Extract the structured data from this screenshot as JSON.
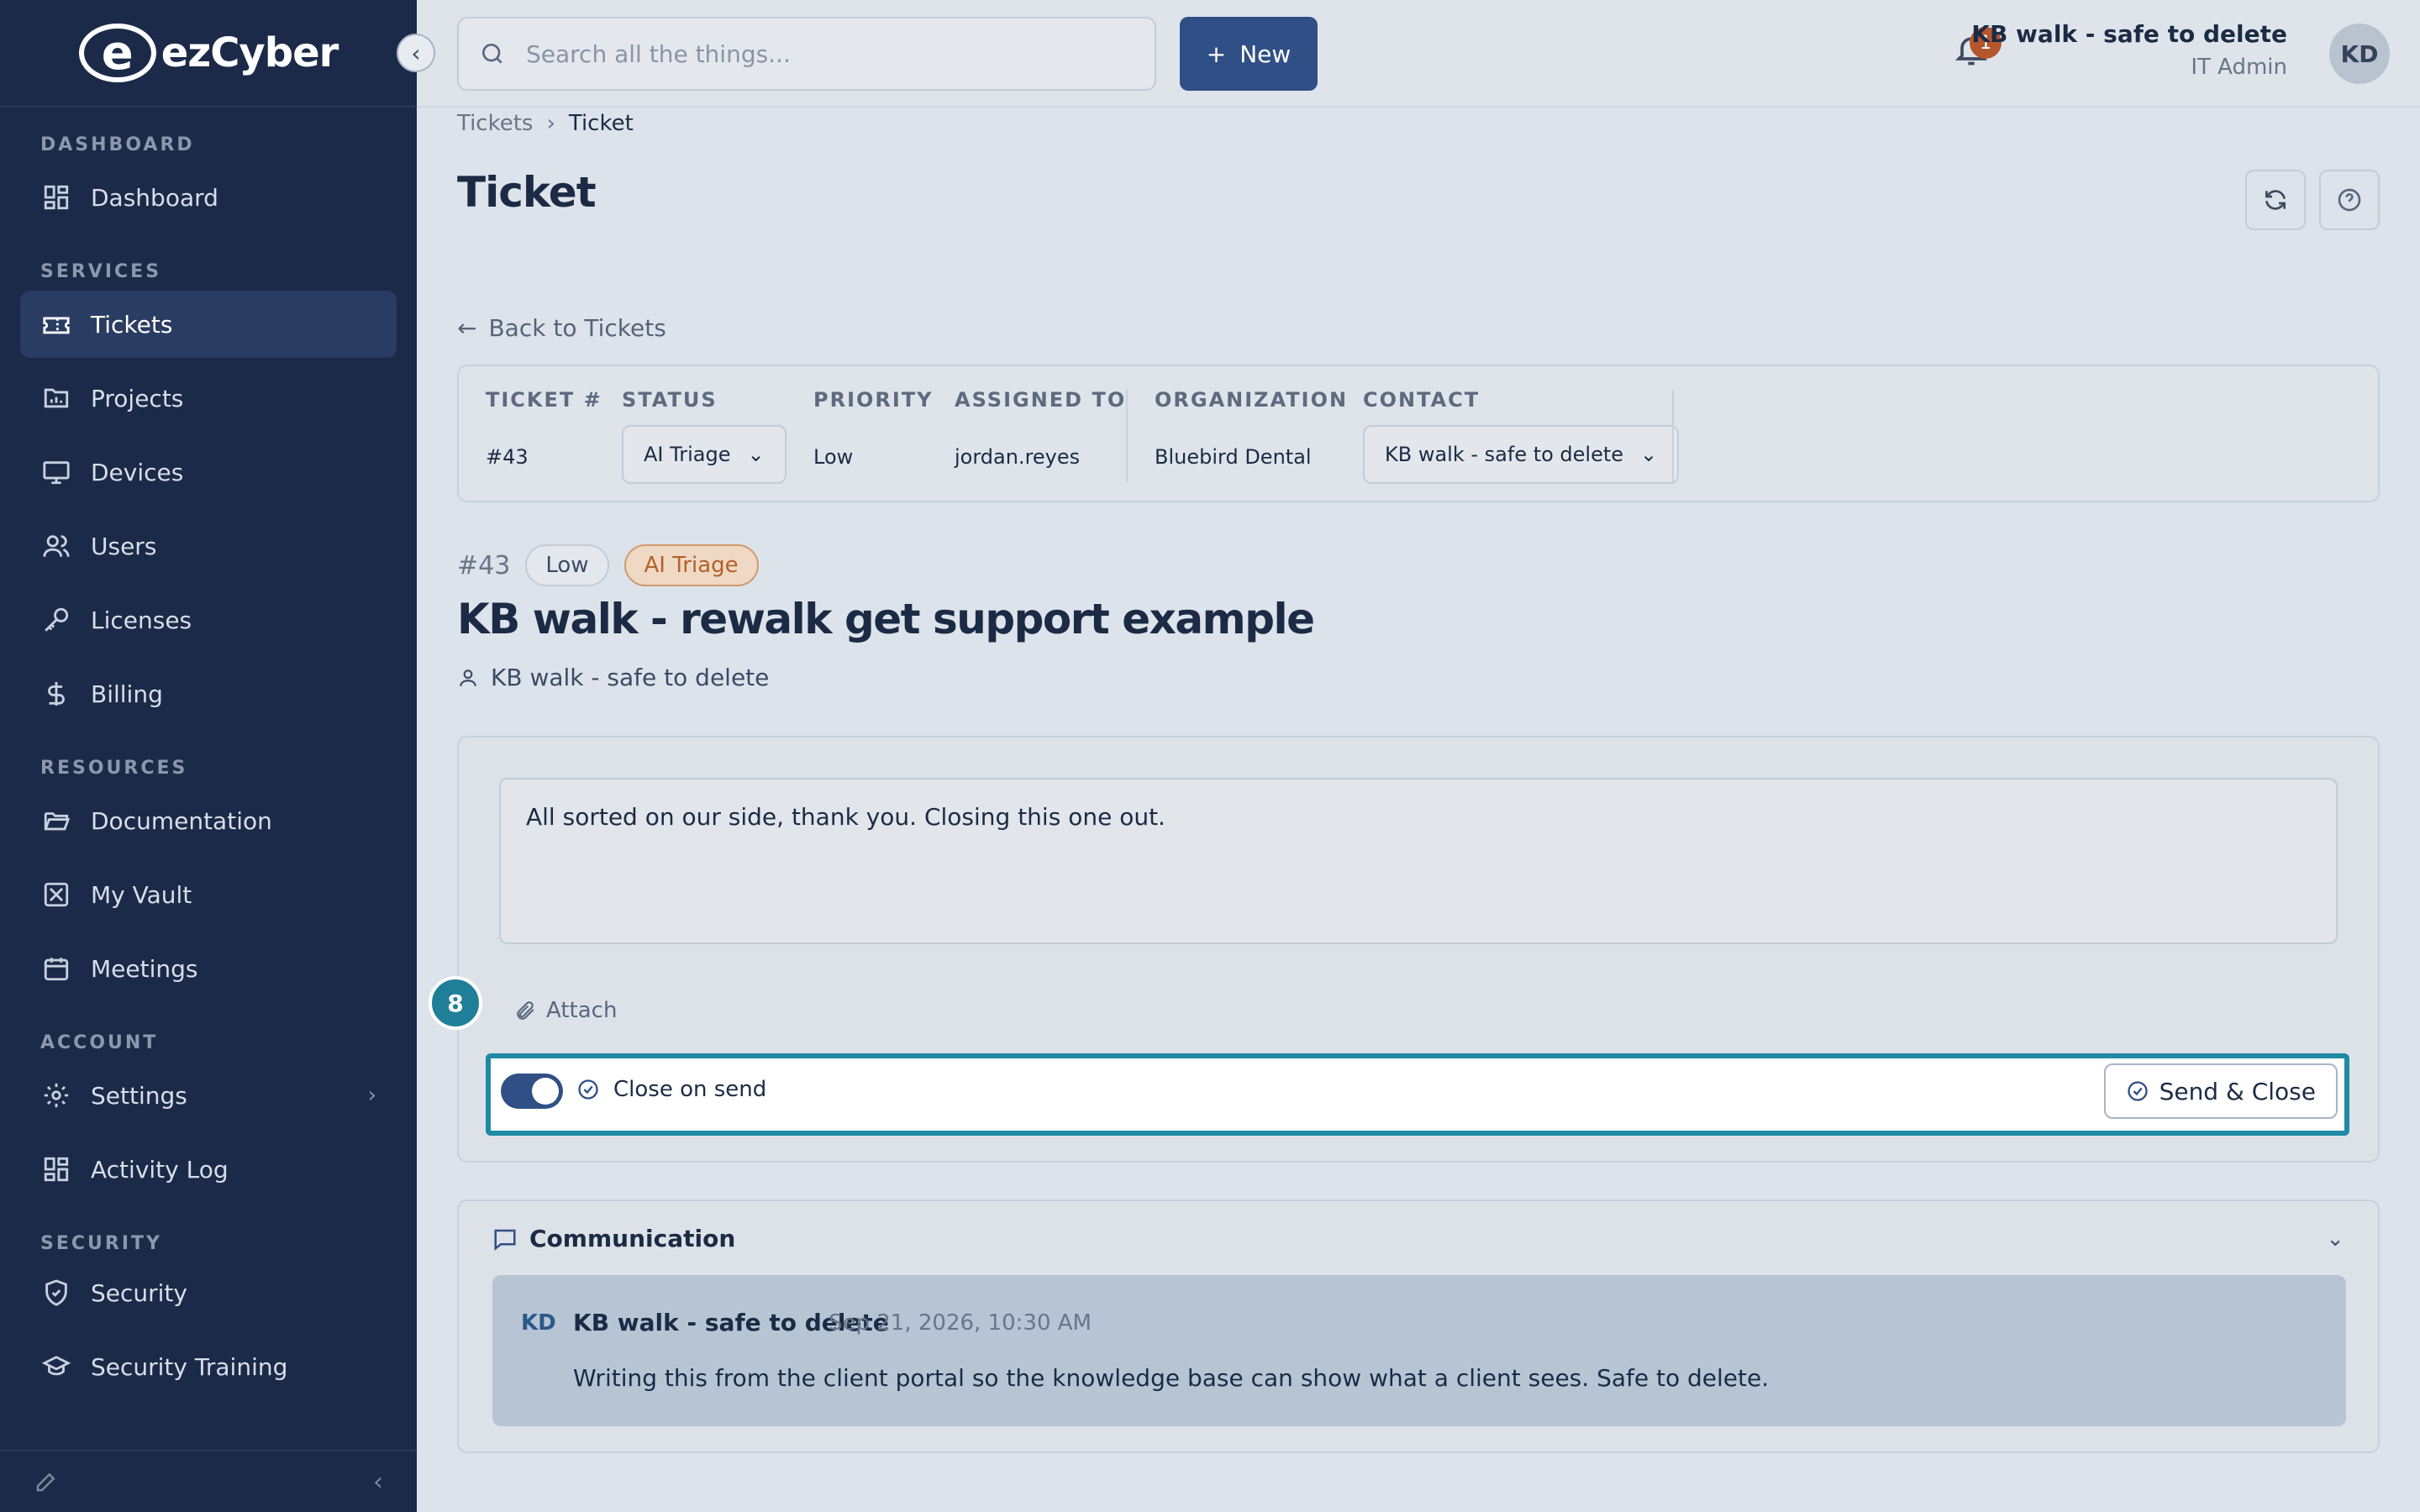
{
  "brand": {
    "name": "ezCyber",
    "mark": "e"
  },
  "sidebar": {
    "sections": [
      {
        "title": "DASHBOARD",
        "items": [
          {
            "label": "Dashboard",
            "icon": "grid-icon"
          }
        ]
      },
      {
        "title": "SERVICES",
        "items": [
          {
            "label": "Tickets",
            "icon": "ticket-icon",
            "active": true
          },
          {
            "label": "Projects",
            "icon": "folder-chart-icon"
          },
          {
            "label": "Devices",
            "icon": "monitor-icon"
          },
          {
            "label": "Users",
            "icon": "users-icon"
          },
          {
            "label": "Licenses",
            "icon": "key-icon"
          },
          {
            "label": "Billing",
            "icon": "dollar-icon"
          }
        ]
      },
      {
        "title": "RESOURCES",
        "items": [
          {
            "label": "Documentation",
            "icon": "folder-open-icon"
          },
          {
            "label": "My Vault",
            "icon": "vault-icon"
          },
          {
            "label": "Meetings",
            "icon": "calendar-icon"
          }
        ]
      },
      {
        "title": "ACCOUNT",
        "items": [
          {
            "label": "Settings",
            "icon": "gear-icon",
            "expandable": true
          },
          {
            "label": "Activity Log",
            "icon": "grid-icon"
          }
        ]
      },
      {
        "title": "SECURITY",
        "items": [
          {
            "label": "Security",
            "icon": "shield-icon"
          },
          {
            "label": "Security Training",
            "icon": "graduation-cap-icon"
          }
        ]
      }
    ]
  },
  "topbar": {
    "search_placeholder": "Search all the things...",
    "new_label": "New",
    "notification_count": "1",
    "user_name": "KB walk - safe to delete",
    "user_role": "IT Admin",
    "user_initials": "KD"
  },
  "breadcrumb": {
    "parent": "Tickets",
    "current": "Ticket"
  },
  "page_title": "Ticket",
  "back_label": "Back to Tickets",
  "meta": {
    "ticket_no_h": "TICKET #",
    "ticket_no": "#43",
    "status_h": "STATUS",
    "status": "AI Triage",
    "priority_h": "PRIORITY",
    "priority": "Low",
    "assigned_h": "ASSIGNED TO",
    "assigned": "jordan.reyes",
    "org_h": "ORGANIZATION",
    "org": "Bluebird Dental",
    "contact_h": "CONTACT",
    "contact": "KB walk - safe to delete"
  },
  "ticket": {
    "id": "#43",
    "priority_tag": "Low",
    "status_tag": "AI Triage",
    "title": "KB walk - rewalk get support example",
    "submitter": "KB walk - safe to delete"
  },
  "reply": {
    "text": "All sorted on our side, thank you. Closing this one out.",
    "attach_label": "Attach",
    "step_number": "8",
    "close_on_send_label": "Close on send",
    "close_on_send": true,
    "send_label": "Send & Close"
  },
  "communication": {
    "title": "Communication",
    "messages": [
      {
        "initials": "KD",
        "author": "KB walk - safe to delete",
        "time": "Sep 21, 2026, 10:30 AM",
        "text": "Writing this from the client portal so the knowledge base can show what a client sees. Safe to delete."
      }
    ]
  },
  "colors": {
    "sidebar": "#1b2a48",
    "primary": "#304f86",
    "highlight": "#1f8aa3",
    "orange": "#b4612a"
  }
}
